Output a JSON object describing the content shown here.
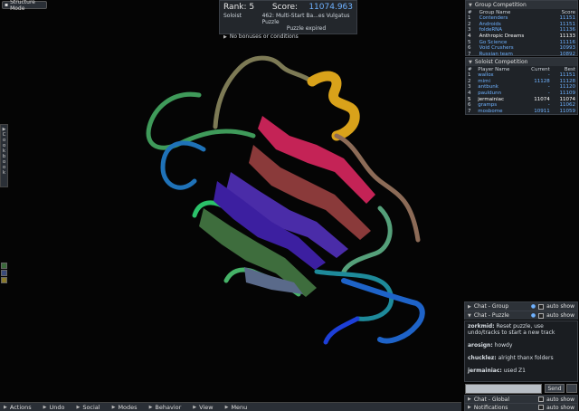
{
  "mode_button": {
    "label": "Structure Mode"
  },
  "score_panel": {
    "rank_label": "Rank: 5",
    "score_label": "Score:",
    "score_value": "11074.963",
    "type": "Soloist",
    "puzzle_title": "462: Multi-Start Ba...es Vulgatus Puzzle",
    "status": "Puzzle expired",
    "bonuses": "No bonuses or conditions"
  },
  "group_competition": {
    "title": "Group Competition",
    "headers": [
      "#",
      "Group Name",
      "Score"
    ],
    "rows": [
      {
        "rank": "1",
        "name": "Contenders",
        "score": "11151"
      },
      {
        "rank": "2",
        "name": "Androids",
        "score": "11151"
      },
      {
        "rank": "3",
        "name": "foldeRNA",
        "score": "11136"
      },
      {
        "rank": "4",
        "name": "Anthropic Dreams",
        "score": "11133"
      },
      {
        "rank": "5",
        "name": "Go Science",
        "score": "11116"
      },
      {
        "rank": "6",
        "name": "Void Crushers",
        "score": "10993"
      },
      {
        "rank": "7",
        "name": "Russian team",
        "score": "10892"
      }
    ]
  },
  "soloist_competition": {
    "title": "Soloist Competition",
    "headers": [
      "#",
      "Player Name",
      "Current",
      "Best"
    ],
    "rows": [
      {
        "rank": "1",
        "name": "wallox",
        "current": "-",
        "best": "11151"
      },
      {
        "rank": "2",
        "name": "mimi",
        "current": "11128",
        "best": "11128"
      },
      {
        "rank": "3",
        "name": "antbunk",
        "current": "-",
        "best": "11120"
      },
      {
        "rank": "4",
        "name": "pauldunn",
        "current": "-",
        "best": "11109"
      },
      {
        "rank": "5",
        "name": "jermainiac",
        "current": "11074",
        "best": "11074"
      },
      {
        "rank": "6",
        "name": "gramps",
        "current": "-",
        "best": "11062"
      },
      {
        "rank": "7",
        "name": "mosbome",
        "current": "10911",
        "best": "11059"
      }
    ]
  },
  "cookbook": {
    "label": "Cookbook"
  },
  "bottom_bar": {
    "items": [
      "Actions",
      "Undo",
      "Social",
      "Modes",
      "Behavior",
      "View",
      "Menu"
    ]
  },
  "chat_group": {
    "title": "Chat - Group",
    "auto_show": "auto show"
  },
  "chat_puzzle": {
    "title": "Chat - Puzzle",
    "auto_show": "auto show",
    "messages": [
      {
        "user": "zorkmid:",
        "text": "Reset puzzle, use undo/tracks to start a new track"
      },
      {
        "user": "arosign:",
        "text": "howdy"
      },
      {
        "user": "chucklez:",
        "text": "alright thanx folders"
      },
      {
        "user": "jermainiac:",
        "text": "used Z1"
      }
    ],
    "send_label": "Send"
  },
  "chat_global": {
    "title": "Chat - Global",
    "auto_show": "auto show"
  },
  "notifications": {
    "title": "Notifications",
    "auto_show": "auto show"
  }
}
